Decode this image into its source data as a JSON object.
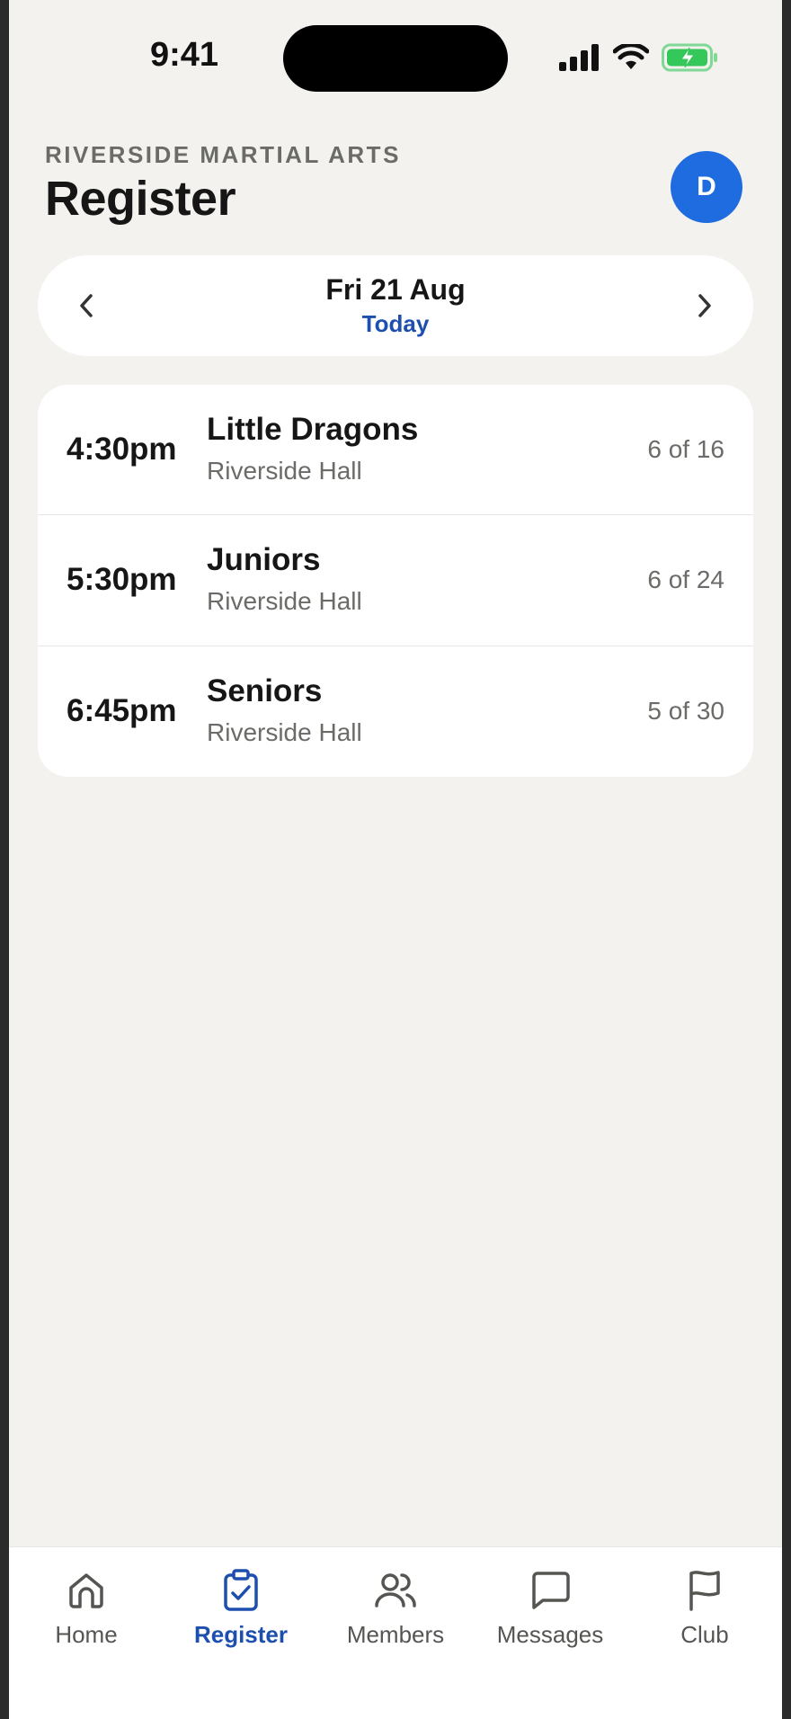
{
  "status_bar": {
    "time": "9:41"
  },
  "header": {
    "club_name": "RIVERSIDE MARTIAL ARTS",
    "title": "Register",
    "avatar_initial": "D"
  },
  "date_nav": {
    "date": "Fri 21 Aug",
    "relative": "Today",
    "prev_icon": "chevron-left-icon",
    "next_icon": "chevron-right-icon"
  },
  "classes": [
    {
      "time": "4:30pm",
      "name": "Little Dragons",
      "venue": "Riverside Hall",
      "count": "6 of 16"
    },
    {
      "time": "5:30pm",
      "name": "Juniors",
      "venue": "Riverside Hall",
      "count": "6 of 24"
    },
    {
      "time": "6:45pm",
      "name": "Seniors",
      "venue": "Riverside Hall",
      "count": "5 of 30"
    }
  ],
  "tabs": [
    {
      "label": "Home",
      "icon": "home-icon",
      "active": false
    },
    {
      "label": "Register",
      "icon": "clipboard-check-icon",
      "active": true
    },
    {
      "label": "Members",
      "icon": "users-icon",
      "active": false
    },
    {
      "label": "Messages",
      "icon": "message-icon",
      "active": false
    },
    {
      "label": "Club",
      "icon": "flag-icon",
      "active": false
    }
  ],
  "colors": {
    "accent": "#1d4fae",
    "avatar": "#1f6be0",
    "background": "#f3f2ef",
    "battery": "#34c759"
  }
}
